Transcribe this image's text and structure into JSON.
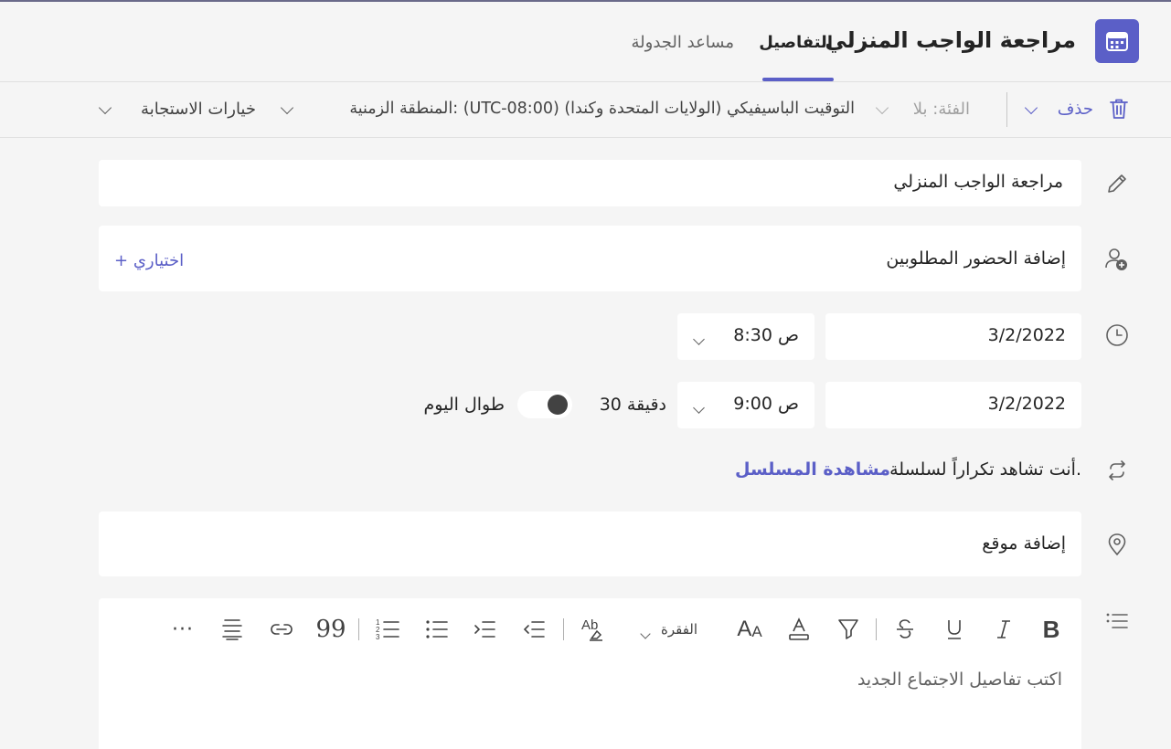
{
  "header": {
    "app_icon": "calendar-icon",
    "title": "مراجعة الواجب المنزلي",
    "tabs": [
      {
        "label": "التفاصيل",
        "active": true
      },
      {
        "label": "مساعد الجدولة",
        "active": false
      }
    ]
  },
  "toolbar": {
    "delete_label": "حذف",
    "category_label": "الفئة: بلا",
    "timezone_label": "المنطقة الزمنية: (UTC-08:00) التوقيت الباسيفيكي (الولايات المتحدة وكندا)",
    "response_options_label": "خيارات الاستجابة"
  },
  "form": {
    "title_value": "مراجعة الواجب المنزلي",
    "attendees_placeholder": "إضافة الحضور المطلوبين",
    "optional_label": "+ اختياري",
    "start_date": "3/2/2022",
    "start_time": "8:30 ص",
    "end_date": "3/2/2022",
    "end_time": "9:00 ص",
    "duration": "30 دقيقة",
    "all_day_label": "طوال اليوم",
    "all_day_on": true,
    "recurrence_text": "أنت تشاهد تكراراً لسلسلة.",
    "view_series_link": "مشاهدة المسلسل",
    "location_placeholder": "إضافة موقع",
    "paragraph_style": "الفقرة",
    "details_placeholder": "اكتب تفاصيل الاجتماع الجديد"
  },
  "colors": {
    "accent": "#5b5fc7",
    "background": "#f5f5f5",
    "card": "#ffffff"
  }
}
